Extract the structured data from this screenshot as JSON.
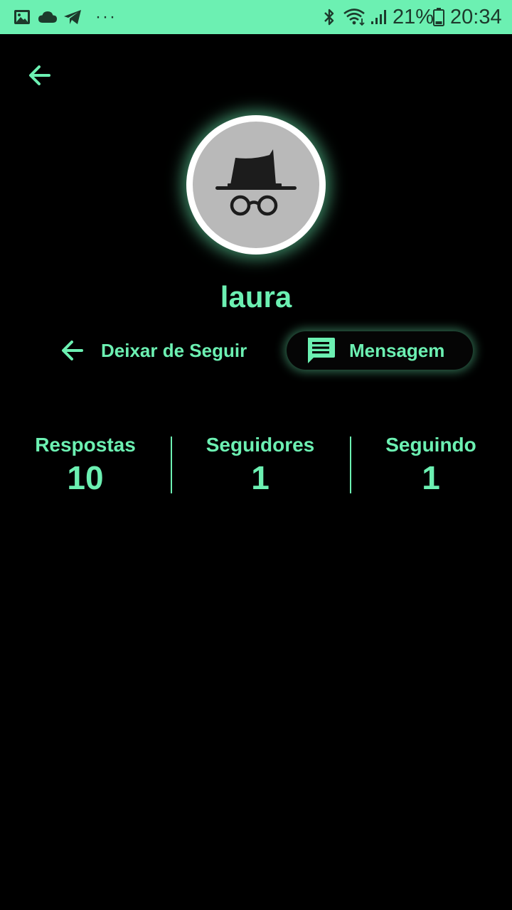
{
  "status_bar": {
    "battery_percent": "21%",
    "time": "20:34",
    "overflow": "···",
    "icons": [
      "gallery-icon",
      "cloud-icon",
      "telegram-icon",
      "bluetooth-icon",
      "wifi-icon",
      "signal-icon",
      "battery-icon"
    ]
  },
  "profile": {
    "username": "laura",
    "avatar_icon": "incognito-icon"
  },
  "actions": {
    "unfollow_label": "Deixar de Seguir",
    "message_label": "Mensagem"
  },
  "stats": [
    {
      "label": "Respostas",
      "value": "10"
    },
    {
      "label": "Seguidores",
      "value": "1"
    },
    {
      "label": "Seguindo",
      "value": "1"
    }
  ],
  "colors": {
    "accent": "#6cf0b2",
    "background": "#000000",
    "avatar_bg": "#b9b9b9"
  }
}
